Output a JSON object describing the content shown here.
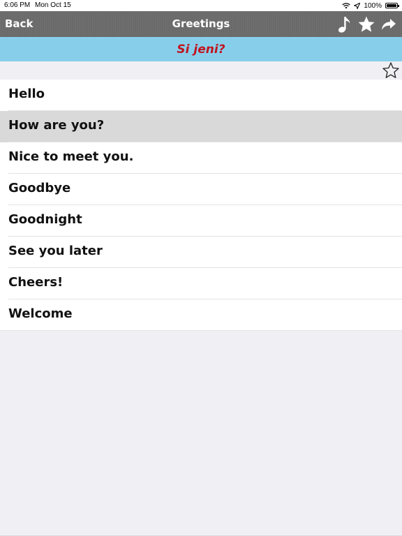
{
  "status_bar": {
    "time": "6:06 PM",
    "date": "Mon Oct 15",
    "battery": "100%",
    "icons": [
      "wifi-icon",
      "location-icon",
      "battery-icon"
    ]
  },
  "nav": {
    "back_label": "Back",
    "title": "Greetings",
    "icons": [
      "music-note-icon",
      "star-icon",
      "share-icon"
    ]
  },
  "translation": {
    "text": "Si jeni?",
    "color": "#c0141e"
  },
  "favorite": {
    "icon": "star-outline-icon"
  },
  "phrases": [
    {
      "label": "Hello"
    },
    {
      "label": "How are you?"
    },
    {
      "label": "Nice to meet you."
    },
    {
      "label": "Goodbye"
    },
    {
      "label": "Goodnight"
    },
    {
      "label": "See you later"
    },
    {
      "label": "Cheers!"
    },
    {
      "label": "Welcome"
    }
  ],
  "selected_index": 1,
  "colors": {
    "nav_background": "#6a6a6a",
    "banner_background": "#87ceeb",
    "selected_row": "#d9d9d9",
    "page_background": "#efeff4"
  }
}
